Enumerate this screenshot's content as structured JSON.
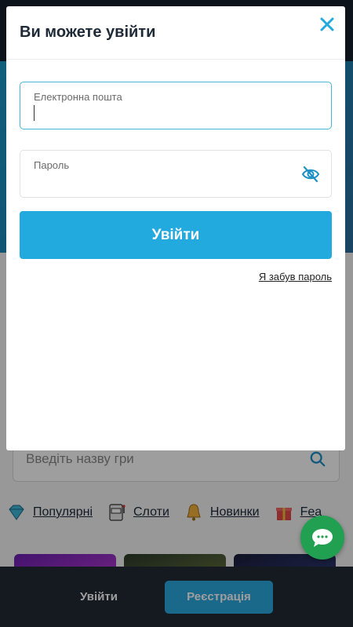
{
  "modal": {
    "title": "Ви можете увійти",
    "email_label": "Електронна пошта",
    "email_value": "",
    "password_label": "Пароль",
    "password_value": "",
    "login_button": "Увійти",
    "forgot_link": "Я забув пароль"
  },
  "search": {
    "placeholder": "Введіть назву гри"
  },
  "categories": [
    {
      "label": "Популярні",
      "icon": "diamond-icon"
    },
    {
      "label": "Слоти",
      "icon": "slot-machine-icon"
    },
    {
      "label": "Новинки",
      "icon": "bell-icon"
    },
    {
      "label": "Fea",
      "icon": "gift-icon"
    }
  ],
  "bottom_bar": {
    "login_label": "Увійти",
    "register_label": "Реєстрація"
  },
  "colors": {
    "accent": "#22aadf",
    "focus_border": "#49b5d3",
    "chat": "#20a050",
    "dark_bar": "#222b36"
  }
}
